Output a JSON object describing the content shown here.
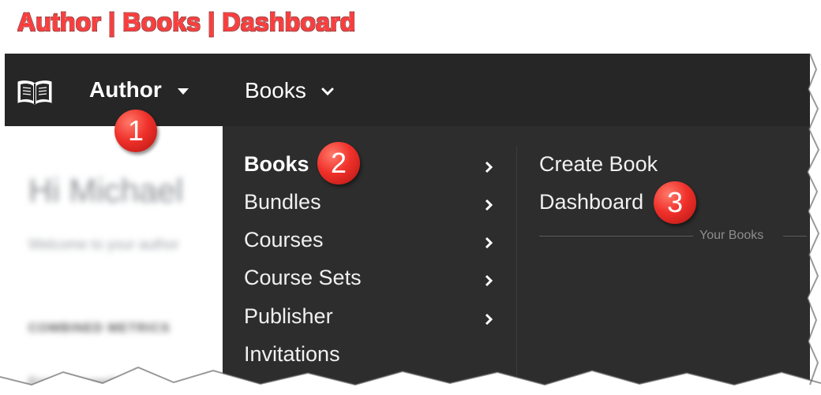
{
  "caption": "Author | Books | Dashboard",
  "topnav": {
    "icon": "open-book-icon",
    "author_label": "Author",
    "books_label": "Books"
  },
  "background_page": {
    "greeting": "Hi Michael",
    "welcome": "Welcome to your author",
    "section_heading": "COMBINED METRICS",
    "from_text": "From November"
  },
  "menu": {
    "items": [
      {
        "label": "Books",
        "has_submenu": true,
        "active": true
      },
      {
        "label": "Bundles",
        "has_submenu": true
      },
      {
        "label": "Courses",
        "has_submenu": true
      },
      {
        "label": "Course Sets",
        "has_submenu": true
      },
      {
        "label": "Publisher",
        "has_submenu": true
      },
      {
        "label": "Invitations",
        "has_submenu": false
      }
    ],
    "submenu": {
      "items": [
        "Create Book",
        "Dashboard"
      ],
      "section_label": "Your Books"
    }
  },
  "badges": [
    "1",
    "2",
    "3"
  ],
  "colors": {
    "topbar": "#262626",
    "menu": "#2d2d2d",
    "badge": "#f0312b",
    "caption": "#ff3b3b"
  }
}
